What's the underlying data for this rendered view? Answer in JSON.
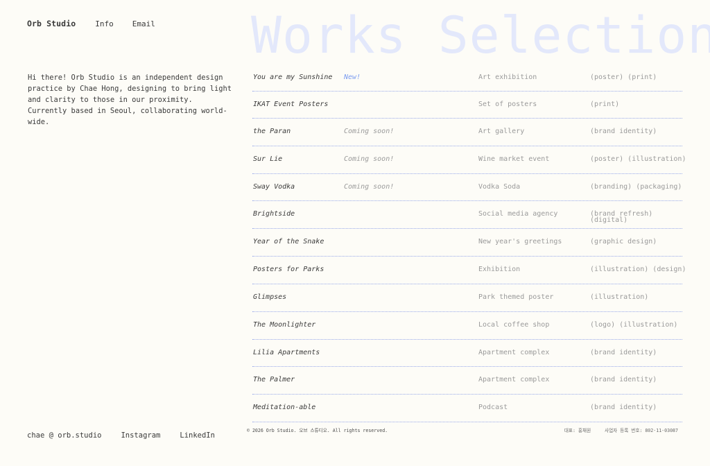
{
  "nav": {
    "brand": "Orb Studio",
    "links": [
      "Info",
      "Email"
    ]
  },
  "page_title": "Works Selection",
  "intro": "Hi there! Orb Studio is an independent design practice by Chae Hong, designing to bring light and clarity to those in our proximity. Currently based in Seoul, collaborating world-wide.",
  "works": [
    {
      "name": "You are my Sunshine",
      "note": "New!",
      "desc": "Art exhibition",
      "tags": "(poster) (print)"
    },
    {
      "name": "IKAT Event Posters",
      "note": "",
      "desc": "Set of posters",
      "tags": "(print)"
    },
    {
      "name": "the Paran",
      "note": "Coming soon!",
      "desc": "Art gallery",
      "tags": "(brand identity)"
    },
    {
      "name": "Sur Lie",
      "note": "Coming soon!",
      "desc": "Wine market event",
      "tags": "(poster) (illustration)"
    },
    {
      "name": "Sway Vodka",
      "note": "Coming soon!",
      "desc": "Vodka Soda",
      "tags": "(branding) (packaging)"
    },
    {
      "name": "Brightside",
      "note": "",
      "desc": "Social media agency",
      "tags": "(brand refresh) (digital)"
    },
    {
      "name": "Year of the Snake",
      "note": "",
      "desc": "New year's greetings",
      "tags": "(graphic design)"
    },
    {
      "name": "Posters for Parks",
      "note": "",
      "desc": "Exhibition",
      "tags": "(illustration) (design)"
    },
    {
      "name": "Glimpses",
      "note": "",
      "desc": "Park themed poster",
      "tags": "(illustration)"
    },
    {
      "name": "The Moonlighter",
      "note": "",
      "desc": "Local coffee shop",
      "tags": "(logo) (illustration)"
    },
    {
      "name": "Lilia Apartments",
      "note": "",
      "desc": "Apartment complex",
      "tags": "(brand identity)"
    },
    {
      "name": "The Palmer",
      "note": "",
      "desc": "Apartment complex",
      "tags": "(brand identity)"
    },
    {
      "name": "Meditation-able",
      "note": "",
      "desc": "Podcast",
      "tags": "(brand identity)"
    }
  ],
  "footer": {
    "email": "chae @ orb.studio",
    "instagram": "Instagram",
    "linkedin": "LinkedIn",
    "copyright": "© 2026 Orb Studio. 오브 스튜디오. All rights reserved.",
    "representative": "대표: 홍채원",
    "business_number": "사업자 등록 번호: 802-11-03087"
  },
  "colors": {
    "background": "#fdfcf7",
    "title": "#e3e8fb",
    "divider": "#97a8e8",
    "new_badge": "#7b9cf0"
  }
}
